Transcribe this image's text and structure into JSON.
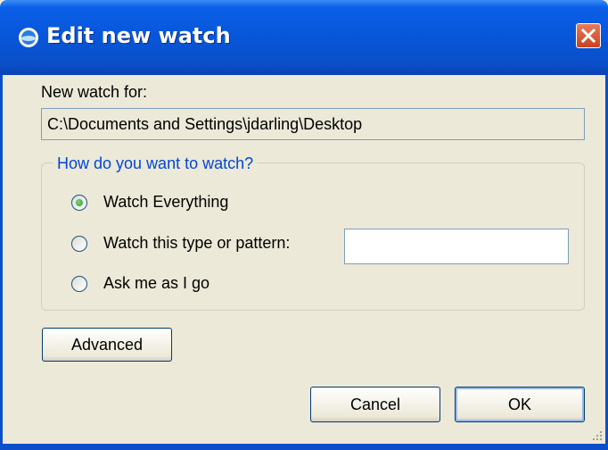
{
  "window": {
    "title": "Edit new watch",
    "icon": "app-globe-icon",
    "close_icon": "close-icon"
  },
  "watch_for": {
    "label": "New watch for:",
    "path": "C:\\Documents and Settings\\jdarling\\Desktop"
  },
  "group": {
    "legend": "How do you want to watch?",
    "options": [
      {
        "label": "Watch Everything",
        "checked": true
      },
      {
        "label": "Watch this type or pattern:",
        "checked": false
      },
      {
        "label": "Ask me as I go",
        "checked": false
      }
    ],
    "pattern_value": ""
  },
  "buttons": {
    "advanced": "Advanced",
    "cancel": "Cancel",
    "ok": "OK"
  },
  "colors": {
    "titlebar": "#0a5fe8",
    "legend": "#0046d5",
    "dialog_bg": "#ece9d8"
  }
}
